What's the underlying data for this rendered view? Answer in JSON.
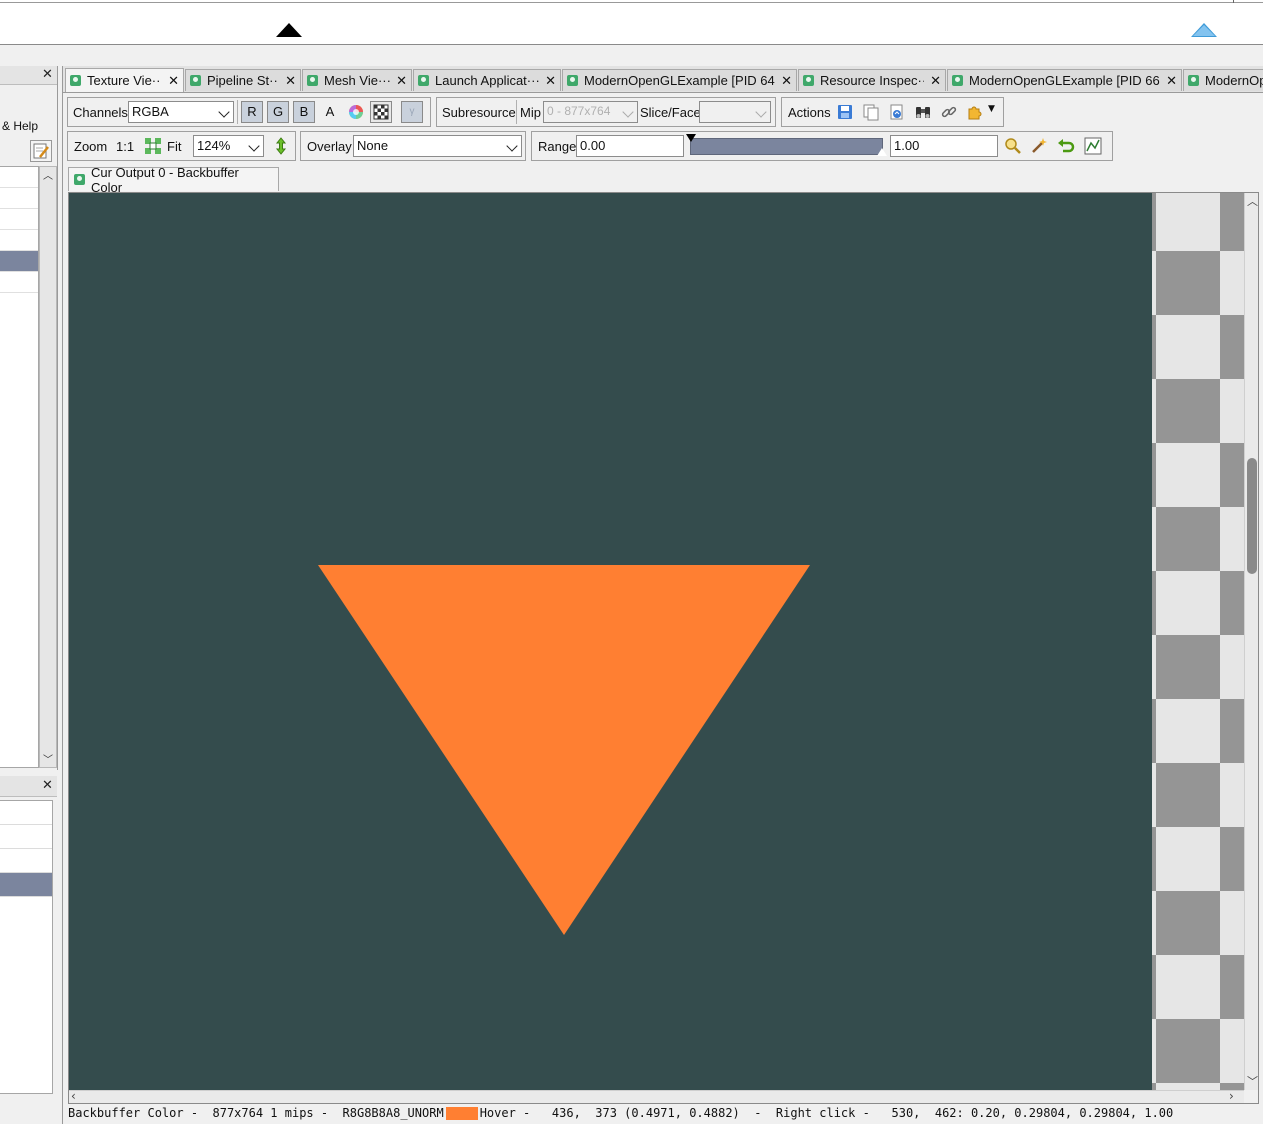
{
  "colors": {
    "background": "#344c4d",
    "triangle": "#ff7f32",
    "accent": "#3fa86a",
    "selection": "#7b859e",
    "marker_blue": "#3f9bd8"
  },
  "left_panel": {
    "help_label": "& Help"
  },
  "tabs": [
    {
      "label": "Texture Vie···",
      "active": true
    },
    {
      "label": "Pipeline St···"
    },
    {
      "label": "Mesh Vie···"
    },
    {
      "label": "Launch Applicat···"
    },
    {
      "label": "ModernOpenGLExample [PID 64···"
    },
    {
      "label": "Resource Inspec···"
    },
    {
      "label": "ModernOpenGLExample [PID 66···"
    },
    {
      "label": "ModernOp"
    }
  ],
  "toolbar1": {
    "channels_label": "Channels",
    "channels_value": "RGBA",
    "r": "R",
    "g": "G",
    "b": "B",
    "a": "A",
    "subresource_label": "Subresource",
    "mip_label": "Mip",
    "mip_value": "0 - 877x764",
    "slice_label": "Slice/Face",
    "slice_value": "",
    "actions_label": "Actions"
  },
  "toolbar2": {
    "zoom_label": "Zoom",
    "zoom_1to1": "1:1",
    "fit_label": "Fit",
    "zoom_value": "124%",
    "overlay_label": "Overlay",
    "overlay_value": "None",
    "range_label": "Range",
    "range_min": "0.00",
    "range_max": "1.00"
  },
  "output_tab": "Cur Output 0 - Backbuffer Color",
  "status": {
    "info": "Backbuffer Color -  877x764 1 mips -  R8G8B8A8_UNORM",
    "hover": "Hover -   436,  373 (0.4971, 0.4882)  -  Right click -   530,  462: 0.20, 0.29804, 0.29804, 1.00"
  }
}
